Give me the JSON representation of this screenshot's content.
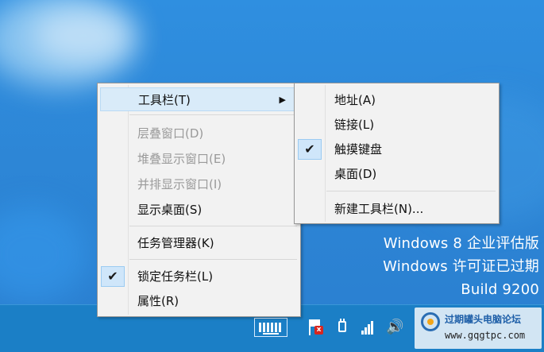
{
  "main_menu": {
    "items": [
      {
        "label": "工具栏(T)",
        "arrow": "▶"
      },
      {
        "label": "层叠窗口(D)"
      },
      {
        "label": "堆叠显示窗口(E)"
      },
      {
        "label": "并排显示窗口(I)"
      },
      {
        "label": "显示桌面(S)"
      },
      {
        "label": "任务管理器(K)"
      },
      {
        "label": "锁定任务栏(L)",
        "check": "✔"
      },
      {
        "label": "属性(R)"
      }
    ]
  },
  "toolbars_submenu": {
    "items": [
      {
        "label": "地址(A)"
      },
      {
        "label": "链接(L)"
      },
      {
        "label": "触摸键盘",
        "check": "✔"
      },
      {
        "label": "桌面(D)"
      },
      {
        "label": "新建工具栏(N)..."
      }
    ]
  },
  "watermark": {
    "line1": "Windows 8 企业评估版",
    "line2": "Windows 许可证已过期",
    "line3": "Build 9200"
  },
  "site_badge": {
    "name": "过期罐头电脑论坛",
    "url": "www.gqgtpc.com"
  },
  "tray": {
    "icons": [
      "touch-keyboard-icon",
      "action-center-flag-icon",
      "power-icon",
      "network-icon",
      "volume-icon"
    ],
    "volume_glyph": "🔊",
    "flag_x": "x"
  }
}
